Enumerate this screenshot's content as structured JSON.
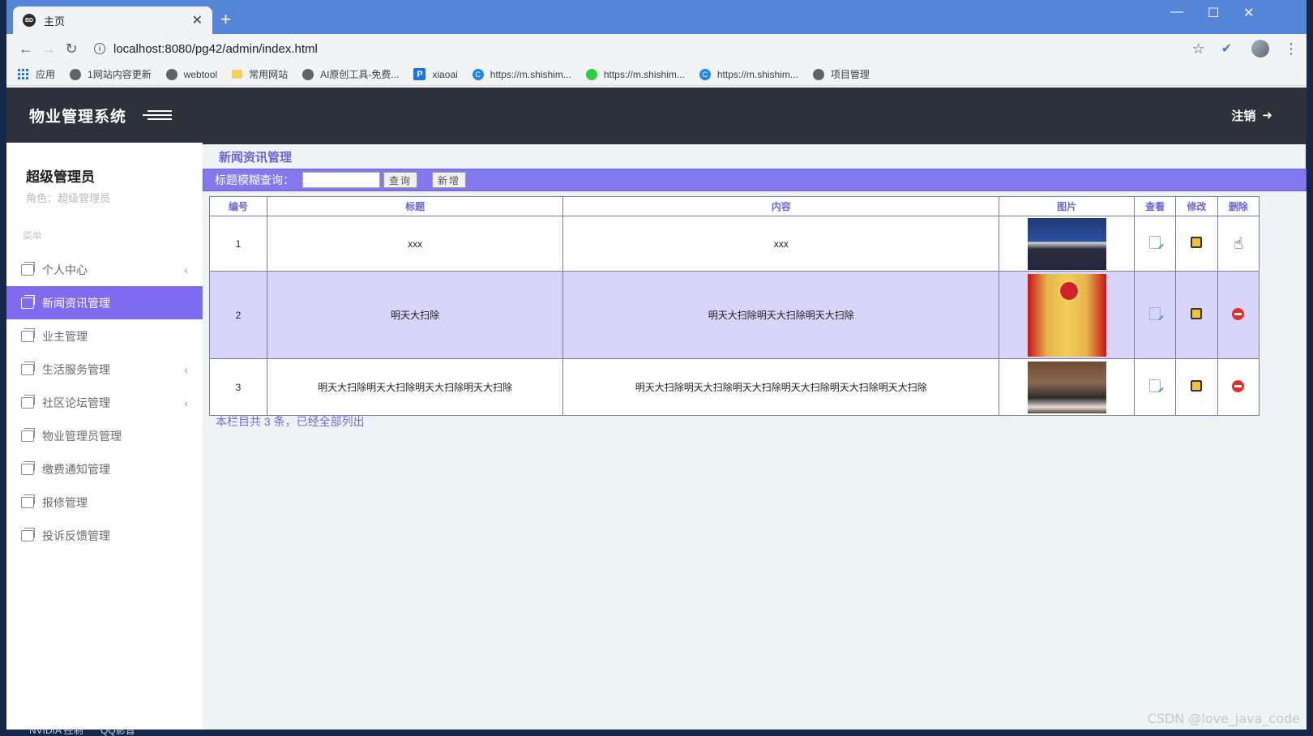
{
  "browser": {
    "tab_title": "主页",
    "tab_favicon_text": "BD",
    "url_display": "localhost:8080/pg42/admin/index.html",
    "bookmarks": [
      {
        "label": "应用",
        "icon": "apps-icon"
      },
      {
        "label": "1网站内容更新",
        "icon": "globe-icon"
      },
      {
        "label": "webtool",
        "icon": "globe-icon"
      },
      {
        "label": "常用网站",
        "icon": "folder-icon"
      },
      {
        "label": "AI原创工具-免费...",
        "icon": "globe-icon"
      },
      {
        "label": "xiaoai",
        "icon": "p-icon"
      },
      {
        "label": "https://m.shishim...",
        "icon": "c-icon"
      },
      {
        "label": "https://m.shishim...",
        "icon": "wechat-icon"
      },
      {
        "label": "https://m.shishim...",
        "icon": "c-icon"
      },
      {
        "label": "项目管理",
        "icon": "globe-icon"
      }
    ]
  },
  "header": {
    "brand": "物业管理系统",
    "logout_label": "注销"
  },
  "sidebar": {
    "user_name": "超级管理员",
    "role_line": "角色：超级管理员",
    "menu_caption": "菜单",
    "items": [
      {
        "label": "个人中心",
        "has_sub": true,
        "active": false
      },
      {
        "label": "新闻资讯管理",
        "has_sub": false,
        "active": true
      },
      {
        "label": "业主管理",
        "has_sub": false,
        "active": false
      },
      {
        "label": "生活服务管理",
        "has_sub": true,
        "active": false
      },
      {
        "label": "社区论坛管理",
        "has_sub": true,
        "active": false
      },
      {
        "label": "物业管理员管理",
        "has_sub": false,
        "active": false
      },
      {
        "label": "缴费通知管理",
        "has_sub": false,
        "active": false
      },
      {
        "label": "报修管理",
        "has_sub": false,
        "active": false
      },
      {
        "label": "投诉反馈管理",
        "has_sub": false,
        "active": false
      }
    ]
  },
  "main": {
    "panel_title": "新闻资讯管理",
    "search_label": "标题模糊查询：",
    "search_value": "",
    "query_button": "查询",
    "add_button": "新增",
    "table": {
      "columns": [
        "编号",
        "标题",
        "内容",
        "图片",
        "查看",
        "修改",
        "删除"
      ],
      "rows": [
        {
          "id": "1",
          "title": "xxx",
          "content": "xxx"
        },
        {
          "id": "2",
          "title": "明天大扫除",
          "content": "明天大扫除明天大扫除明天大扫除"
        },
        {
          "id": "3",
          "title": "明天大扫除明天大扫除明天大扫除明天大扫除",
          "content": "明天大扫除明天大扫除明天大扫除明天大扫除明天大扫除明天大扫除"
        }
      ]
    },
    "footer_note": "本栏目共 3 条，已经全部列出"
  },
  "taskbar": [
    "NVIDIA 控制",
    "QQ影音"
  ],
  "watermark": "CSDN @love_java_code",
  "colors": {
    "accent": "#7e6bf0",
    "header_bg": "#2d3139",
    "row_highlight": "#d8d4fa",
    "tab_strip": "#5585d6"
  }
}
